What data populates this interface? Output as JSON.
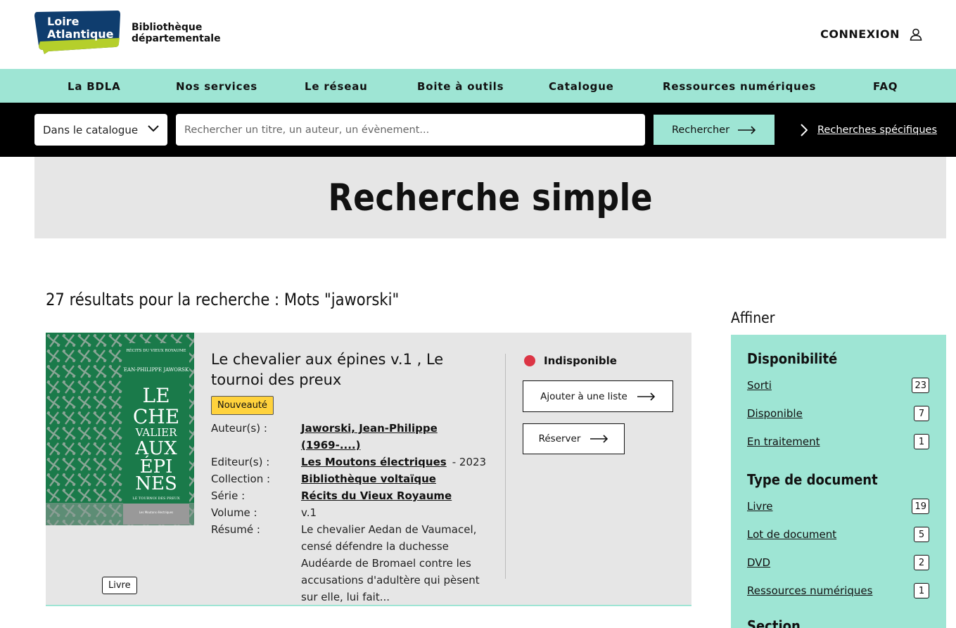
{
  "header": {
    "logo_line1": "Loire",
    "logo_line2": "Atlantique",
    "subtitle_line1": "Bibliothèque",
    "subtitle_line2": "départementale",
    "login_label": "CONNEXION",
    "login_icon": "user-icon"
  },
  "nav": {
    "items": [
      "La BDLA",
      "Nos services",
      "Le réseau",
      "Boite à outils",
      "Catalogue",
      "Ressources numériques",
      "FAQ"
    ]
  },
  "search": {
    "scope": "Dans le catalogue",
    "placeholder": "Rechercher un titre, un auteur, un évènement...",
    "button": "Rechercher",
    "specific_link": "Recherches spécifiques"
  },
  "banner": {
    "title": "Recherche simple"
  },
  "results": {
    "summary": "27 résultats pour la recherche : Mots \"jaworski\"",
    "items": [
      {
        "title": "Le chevalier aux épines v.1 , Le tournoi des preux",
        "badge": "Nouveauté",
        "doc_type": "Livre",
        "fields": {
          "author_label": "Auteur(s) :",
          "author": "Jaworski, Jean-Philippe (1969-....)",
          "publisher_label": "Editeur(s) :",
          "publisher": "Les Moutons électriques",
          "year": "- 2023",
          "collection_label": "Collection :",
          "collection": "Bibliothèque voltaïque",
          "series_label": "Série :",
          "series": "Récits du Vieux Royaume",
          "volume_label": "Volume :",
          "volume": "v.1",
          "summary_label": "Résumé :",
          "summary": "Le chevalier Aedan de Vaumacel, censé défendre la duchesse Audéarde de Bromael contre les accusations d'adultère qui pèsent sur elle, lui fait..."
        },
        "availability": "Indisponible",
        "availability_color": "#dc3545",
        "add_to_list": "Ajouter à une liste",
        "reserve": "Réserver",
        "cover": {
          "header": "RÉCITS DU VIEUX ROYAUME",
          "author": "JEAN-PHILIPPE JAWORSKI",
          "title_lines": [
            "LE",
            "CHE",
            "VALIER",
            "AUX",
            "ÉPI",
            "NES"
          ],
          "subtitle": "LE TOURNOI DES PREUX",
          "publisher": "Les Moutons électriques"
        }
      }
    ]
  },
  "sidebar": {
    "title": "Affiner",
    "groups": [
      {
        "title": "Disponibilité",
        "facets": [
          {
            "label": "Sorti",
            "count": "23"
          },
          {
            "label": "Disponible",
            "count": "7"
          },
          {
            "label": "En traitement",
            "count": "1"
          }
        ]
      },
      {
        "title": "Type de document",
        "facets": [
          {
            "label": "Livre",
            "count": "19"
          },
          {
            "label": "Lot de document",
            "count": "5"
          },
          {
            "label": "DVD",
            "count": "2"
          },
          {
            "label": "Ressources numériques",
            "count": "1"
          }
        ]
      },
      {
        "title": "Section",
        "facets": []
      }
    ]
  },
  "colors": {
    "accent": "#9ee5d4",
    "badge_new": "#ffd23c",
    "cover_green": "#1a7a4a",
    "logo_blue": "#0f3d6e",
    "logo_green": "#b5cf2b"
  }
}
